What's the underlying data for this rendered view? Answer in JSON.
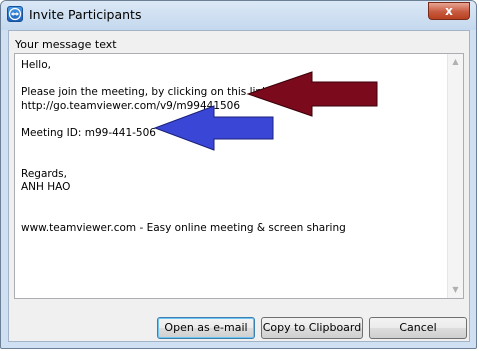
{
  "window": {
    "title": "Invite Participants",
    "close_glyph": "x",
    "icon": "teamviewer-icon"
  },
  "message": {
    "label": "Your message text",
    "lines": [
      "Hello,",
      "",
      "Please join the meeting, by clicking on this link:",
      "http://go.teamviewer.com/v9/m99441506",
      "",
      "Meeting ID: m99-441-506",
      "",
      "",
      "Regards,",
      "ANH HAO",
      "",
      "",
      "www.teamviewer.com - Easy online meeting & screen sharing"
    ]
  },
  "buttons": {
    "open_email": "Open as e-mail",
    "copy_clipboard": "Copy to Clipboard",
    "cancel": "Cancel"
  },
  "annotations": {
    "link_arrow_color": "#7a0a1c",
    "id_arrow_color": "#3a47d6"
  }
}
